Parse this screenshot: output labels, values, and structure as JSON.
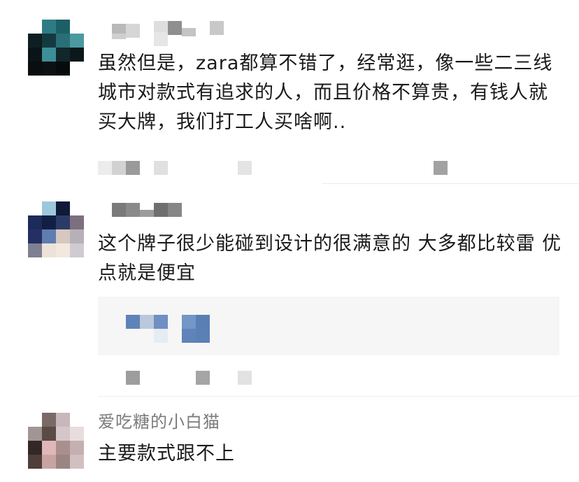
{
  "comments": [
    {
      "username": "",
      "text": "虽然但是，zara都算不错了，经常逛，像一些二三线城市对款式有追求的人，而且价格不算贵，有钱人就买大牌，我们打工人买啥啊.."
    },
    {
      "username": "",
      "text": "这个牌子很少能碰到设计的很满意的 大多都比较雷  优点就是便宜"
    },
    {
      "username": "爱吃糖的小白猫",
      "text": "主要款式跟不上"
    }
  ],
  "icons": {
    "avatar_1": "pixelated-avatar-icon",
    "avatar_2": "pixelated-avatar-icon",
    "avatar_3": "pixelated-avatar-icon"
  }
}
